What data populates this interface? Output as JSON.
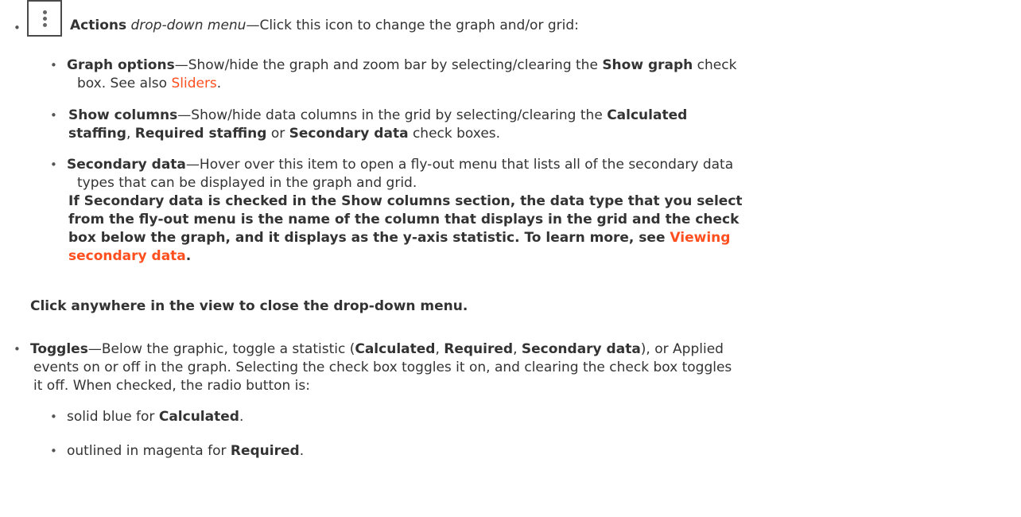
{
  "actions": {
    "title": "Actions",
    "subtitle": "drop-down menu",
    "intro": "—Click this icon to change the graph and/or grid:"
  },
  "graph_options": {
    "title": "Graph options",
    "text1": "—Show/hide the graph and zoom bar by selecting/clearing the ",
    "bold1": "Show graph",
    "text2": " check",
    "text3": "box. See also ",
    "link": "Sliders",
    "text4": "."
  },
  "show_columns": {
    "title": "Show columns",
    "text1": "—Show/hide data columns in the grid by selecting/clearing the ",
    "bold1": "Calculated",
    "bold2": "staffing",
    "sep1": ", ",
    "bold3": "Required staffing",
    "text2": " or ",
    "bold4": "Secondary data",
    "text3": " check boxes."
  },
  "secondary_data": {
    "title": "Secondary data",
    "text1": "—Hover over this item to open a fly-out menu that lists all of the secondary data",
    "text2": "types that can be displayed in the graph and grid.",
    "note1": "If Secondary data is checked in the Show columns section, the data type that you select",
    "note2": "from the fly-out menu is the name of the column that displays in the grid and the check",
    "note3": "box below the graph, and it displays as the y-axis statistic. To learn more, see ",
    "note_link1": "Viewing",
    "note_link2": "secondary data",
    "note_end": "."
  },
  "close_note": "Click anywhere in the view to close the drop-down menu.",
  "toggles": {
    "title": "Toggles",
    "text1": "—Below the graphic, toggle a statistic (",
    "bold1": "Calculated",
    "sep1": ", ",
    "bold2": "Required",
    "sep2": ", ",
    "bold3": "Secondary data",
    "text2": "), or Applied",
    "line2": "events on or off in the graph. Selecting the check box toggles it on, and clearing the check box toggles",
    "line3": "it off. When checked, the radio button is:",
    "item1_text": "solid blue for ",
    "item1_bold": "Calculated",
    "item1_end": ".",
    "item2_text": "outlined in magenta for ",
    "item2_bold": "Required",
    "item2_end": "."
  },
  "bullet_char": "•",
  "colors": {
    "link": "#ff4f1f",
    "text": "#333333"
  }
}
